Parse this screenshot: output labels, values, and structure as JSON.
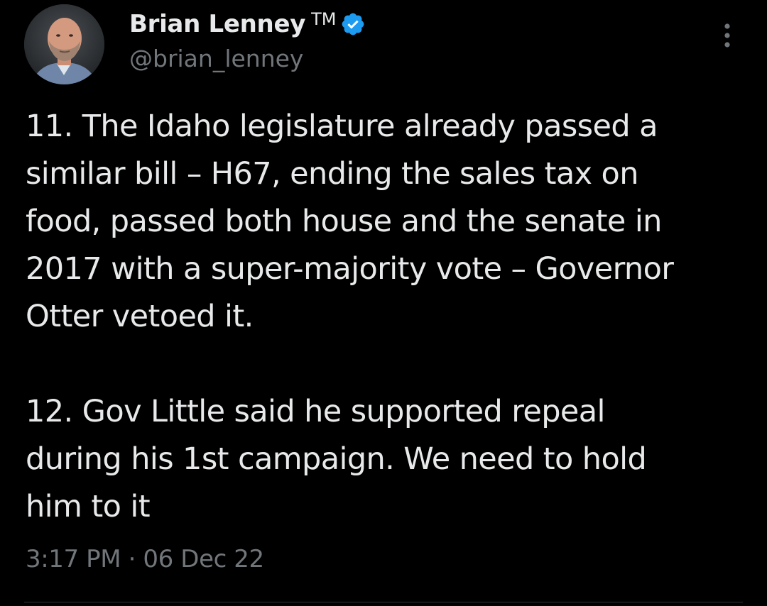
{
  "author": {
    "display_name": "Brian Lenney",
    "name_suffix": "TM",
    "handle": "@brian_lenney",
    "verified": true,
    "avatar_icon": "profile-photo"
  },
  "tweet": {
    "paragraphs": [
      "11. The Idaho legislature already passed a\nsimilar bill – H67, ending the sales tax on\nfood, passed both house and the senate in\n2017 with a super-majority vote – Governor\nOtter vetoed it.",
      "12. Gov Little said he supported repeal\nduring his 1st campaign. We need to hold\nhim to it"
    ],
    "timestamp": "3:17 PM · 06 Dec 22"
  },
  "icons": {
    "more": "more-vertical-icon",
    "verified": "verified-badge-icon"
  },
  "colors": {
    "background": "#000000",
    "text": "#e7e9ea",
    "secondary_text": "#71767b",
    "verified_blue": "#1d9bf0",
    "divider": "#2f3336"
  }
}
